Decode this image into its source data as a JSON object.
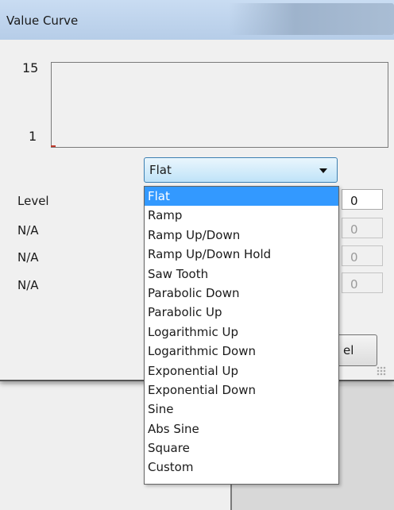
{
  "dialog": {
    "title": "Value Curve",
    "chart": {
      "y_max": "15",
      "y_min": "1"
    },
    "combo": {
      "selected": "Flat"
    },
    "rows": [
      {
        "label": "Level",
        "value": "0",
        "enabled": true
      },
      {
        "label": "N/A",
        "value": "0",
        "enabled": false
      },
      {
        "label": "N/A",
        "value": "0",
        "enabled": false
      },
      {
        "label": "N/A",
        "value": "0",
        "enabled": false
      }
    ],
    "button_partial_label": "el"
  },
  "dropdown": {
    "items": [
      "Flat",
      "Ramp",
      "Ramp Up/Down",
      "Ramp Up/Down Hold",
      "Saw Tooth",
      "Parabolic Down",
      "Parabolic Up",
      "Logarithmic Up",
      "Logarithmic Down",
      "Exponential Up",
      "Exponential Down",
      "Sine",
      "Abs Sine",
      "Square",
      "Custom"
    ],
    "selected_index": 0
  },
  "colors": {
    "selection": "#3399ff",
    "origin_marker": "#c0392b"
  }
}
